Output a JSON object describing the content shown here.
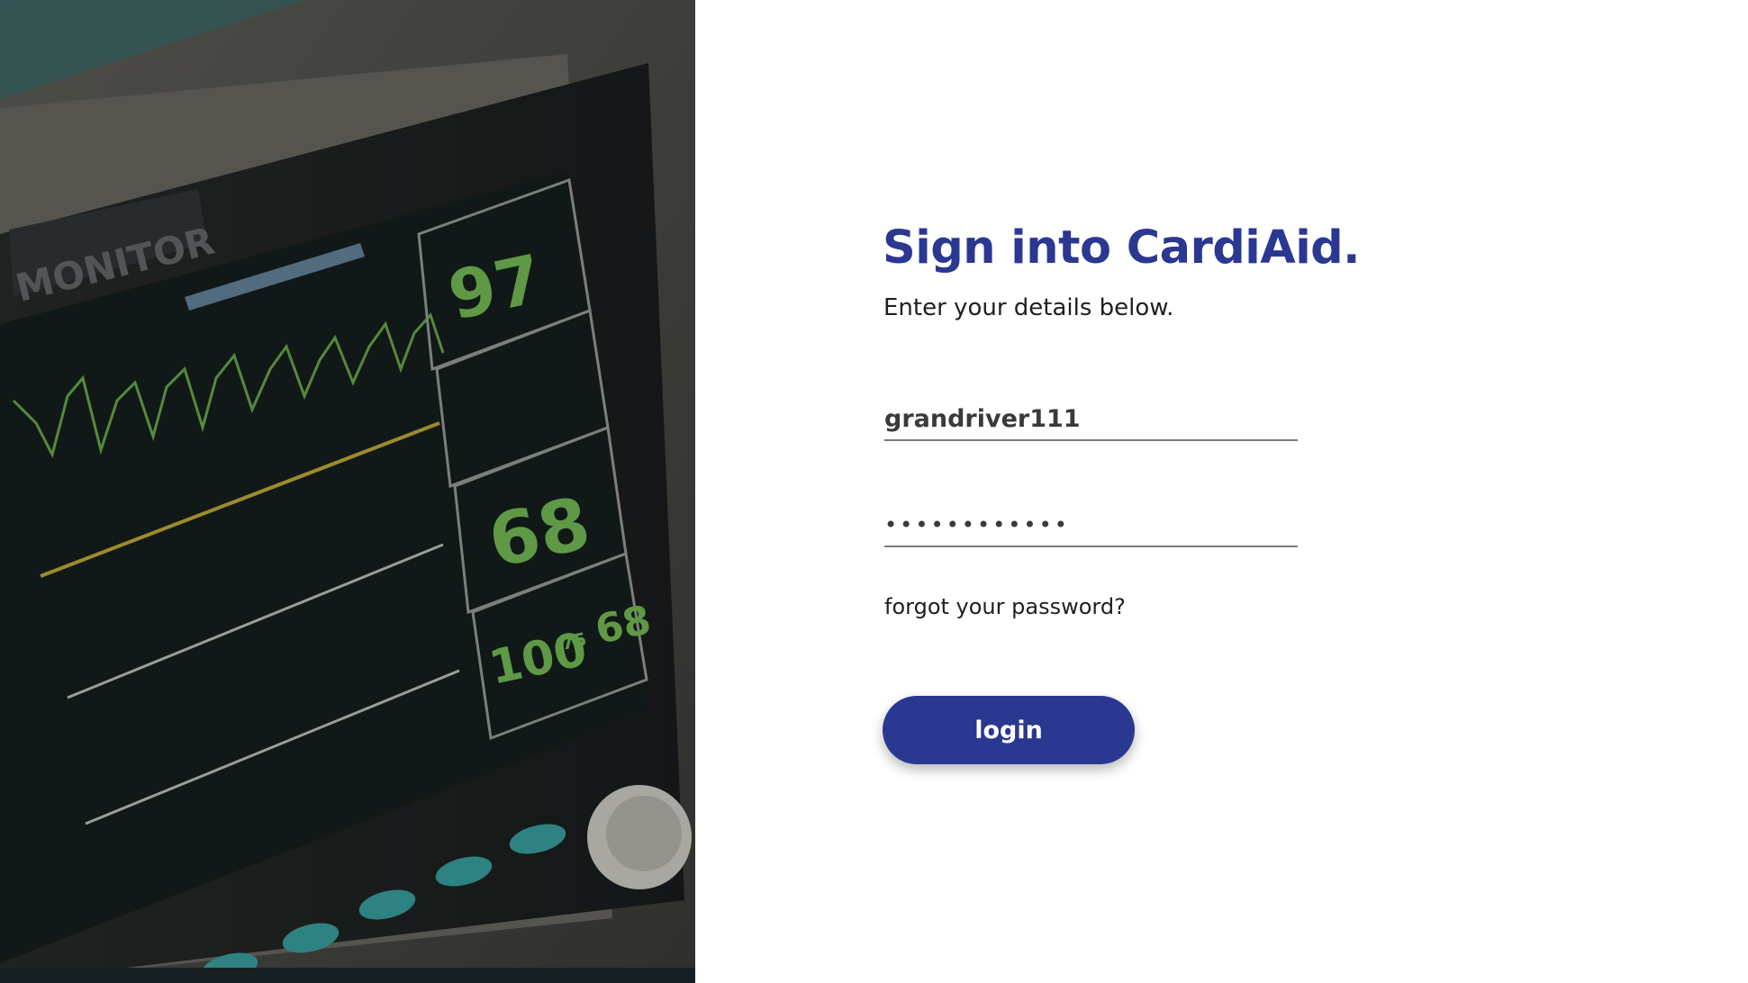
{
  "colors": {
    "accent": "#2b3892",
    "text": "#1f1f1f",
    "field_underline": "#7a7a7a"
  },
  "hero": {
    "image_icon": "patient-monitor-photo",
    "monitor_brand": "MONITOR",
    "readings": {
      "spo2": "97",
      "pulse": "68",
      "nibp_sys": "100",
      "nibp_mid": "75",
      "nibp_dia": "68"
    }
  },
  "login": {
    "title": "Sign into CardiAid.",
    "subtitle": "Enter your details below.",
    "username_value": "grandriver111",
    "password_value": "••••••••••••",
    "forgot_label": "forgot your password?",
    "login_label": "login"
  }
}
